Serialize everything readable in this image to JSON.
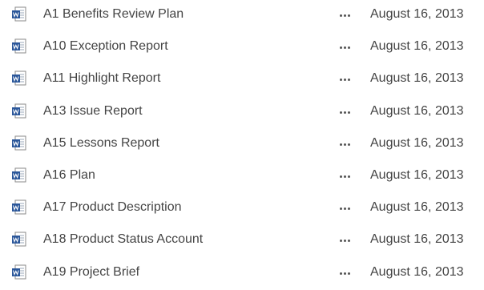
{
  "documents": [
    {
      "name": "A1 Benefits Review Plan",
      "modified": "August 16, 2013",
      "icon": "word-document-icon"
    },
    {
      "name": "A10 Exception Report",
      "modified": "August 16, 2013",
      "icon": "word-document-icon"
    },
    {
      "name": "A11 Highlight Report",
      "modified": "August 16, 2013",
      "icon": "word-document-icon"
    },
    {
      "name": "A13 Issue Report",
      "modified": "August 16, 2013",
      "icon": "word-document-icon"
    },
    {
      "name": "A15 Lessons Report",
      "modified": "August 16, 2013",
      "icon": "word-document-icon"
    },
    {
      "name": "A16 Plan",
      "modified": "August 16, 2013",
      "icon": "word-document-icon"
    },
    {
      "name": "A17 Product Description",
      "modified": "August 16, 2013",
      "icon": "word-document-icon"
    },
    {
      "name": "A18 Product Status Account",
      "modified": "August 16, 2013",
      "icon": "word-document-icon"
    },
    {
      "name": "A19 Project Brief",
      "modified": "August 16, 2013",
      "icon": "word-document-icon"
    }
  ],
  "more_icon": "ellipsis-icon",
  "colors": {
    "word_blue": "#2b579a",
    "text": "#444444"
  }
}
